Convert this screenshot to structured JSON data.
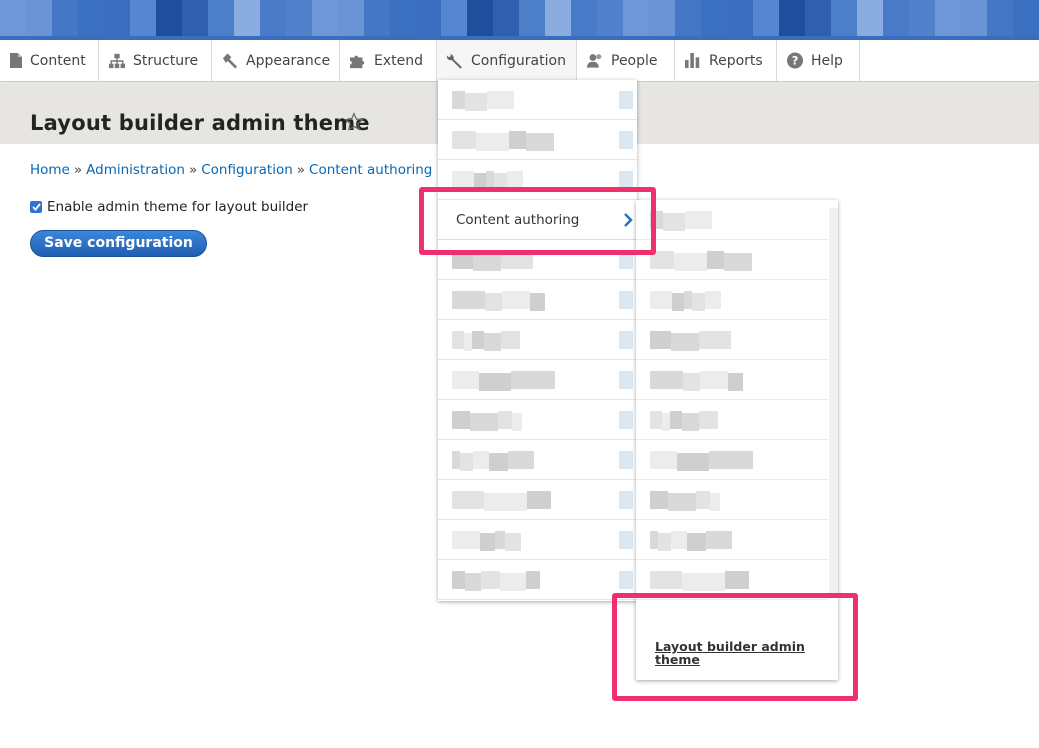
{
  "toolbar": {
    "items": [
      {
        "label": "Content",
        "icon": "document-icon"
      },
      {
        "label": "Structure",
        "icon": "structure-icon"
      },
      {
        "label": "Appearance",
        "icon": "paintbrush-icon"
      },
      {
        "label": "Extend",
        "icon": "puzzle-icon"
      },
      {
        "label": "Configuration",
        "icon": "wrench-icon"
      },
      {
        "label": "People",
        "icon": "people-icon"
      },
      {
        "label": "Reports",
        "icon": "bar-chart-icon"
      },
      {
        "label": "Help",
        "icon": "help-icon"
      }
    ]
  },
  "page": {
    "title": "Layout builder admin theme",
    "breadcrumb": [
      "Home",
      "Administration",
      "Configuration",
      "Content authoring"
    ],
    "breadcrumb_separator": "»",
    "checkbox_label": "Enable admin theme for layout builder",
    "checkbox_checked": true,
    "save_label": "Save configuration"
  },
  "menu": {
    "content_authoring_label": "Content authoring",
    "submenu_link": "Layout builder admin theme"
  },
  "colors": {
    "link": "#0b67b2",
    "highlight": "#f0306c",
    "button": "#2f74d0",
    "header_band": "#e6e5e1"
  }
}
